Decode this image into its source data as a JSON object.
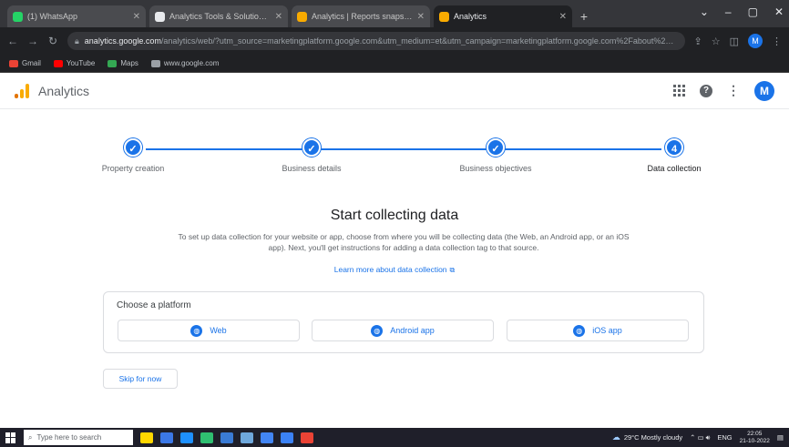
{
  "browser": {
    "tabs": [
      {
        "title": "(1) WhatsApp",
        "favicon_color": "#25d366",
        "active": false
      },
      {
        "title": "Analytics Tools & Solutions for Your Business",
        "favicon_color": "#e8eaed",
        "active": false
      },
      {
        "title": "Analytics | Reports snapshot",
        "favicon_color": "#f9ab00",
        "active": false
      },
      {
        "title": "Analytics",
        "favicon_color": "#f9ab00",
        "active": true
      }
    ],
    "new_tab_label": "+",
    "window_controls": [
      "⌄",
      "–",
      "▢",
      "✕"
    ],
    "url_domain": "analytics.google.com",
    "url_path": "/analytics/web/?utm_source=marketingplatform.google.com&utm_medium=et&utm_campaign=marketingplatform.google.com%2Fabout%2Fanal...",
    "bookmarks": [
      {
        "label": "Gmail",
        "color": "#ea4335"
      },
      {
        "label": "YouTube",
        "color": "#ff0000"
      },
      {
        "label": "Maps",
        "color": "#34a853"
      },
      {
        "label": "www.google.com",
        "color": "#9aa0a6"
      }
    ]
  },
  "app": {
    "title": "Analytics",
    "avatar_letter": "M",
    "help_glyph": "?",
    "more_glyph": "⋮"
  },
  "stepper": {
    "steps": [
      {
        "label": "Property creation",
        "glyph": "✓",
        "state": "done"
      },
      {
        "label": "Business details",
        "glyph": "✓",
        "state": "done"
      },
      {
        "label": "Business objectives",
        "glyph": "✓",
        "state": "done"
      },
      {
        "label": "Data collection",
        "glyph": "4",
        "state": "current"
      }
    ]
  },
  "main": {
    "heading": "Start collecting data",
    "description": "To set up data collection for your website or app, choose from where you will be collecting data (the Web, an Android app, or an iOS app). Next, you'll get instructions for adding a data collection tag to that source.",
    "learn_more": "Learn more about data collection",
    "platform_title": "Choose a platform",
    "platforms": [
      {
        "label": "Web",
        "icon_glyph": "◍"
      },
      {
        "label": "Android app",
        "icon_glyph": "◍"
      },
      {
        "label": "iOS app",
        "icon_glyph": "◍"
      }
    ],
    "skip_label": "Skip for now"
  },
  "taskbar": {
    "search_placeholder": "Type here to search",
    "apps": [
      "#ffd700",
      "#3b78e7",
      "#1e90ff",
      "#2fbf71",
      "#3a7bd5",
      "#6fa8dc",
      "#4285f4",
      "#3b82f6",
      "#ea4335"
    ],
    "weather": "29°C  Mostly cloudy",
    "language": "ENG",
    "time": "22:05",
    "date": "21-10-2022"
  },
  "colors": {
    "accent": "#1a73e8",
    "ga_orange": "#f9ab00",
    "ga_dark_orange": "#e37400"
  }
}
